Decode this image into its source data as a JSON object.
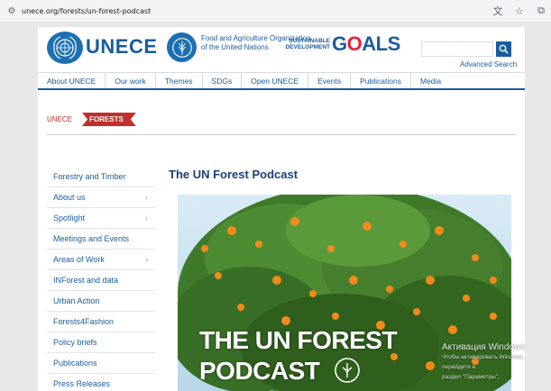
{
  "browser": {
    "url": "unece.org/forests/un-forest-podcast",
    "icons": [
      "tune-icon",
      "translate-icon",
      "star-icon",
      "extensions-icon"
    ]
  },
  "header": {
    "brand": "UNECE",
    "fao_line1": "Food and Agriculture Organization",
    "fao_line2": "of the United Nations",
    "sdg_line1": "SUSTAINABLE",
    "sdg_line2": "DEVELOPMENT",
    "sdg_goals_pre": "G",
    "sdg_goals_o": "O",
    "sdg_goals_post": "ALS",
    "search_placeholder": "",
    "advanced_search": "Advanced Search",
    "colors": {
      "brand_blue": "#1a5c9e",
      "accent_red": "#c12f2a"
    }
  },
  "topnav": {
    "items": [
      "About UNECE",
      "Our work",
      "Themes",
      "SDGs",
      "Open UNECE",
      "Events",
      "Publications",
      "Media"
    ]
  },
  "breadcrumb": {
    "root": "UNECE",
    "current": "FORESTS"
  },
  "sidebar": {
    "items": [
      {
        "label": "Forestry and Timber",
        "has_arrow": false
      },
      {
        "label": "About us",
        "has_arrow": true
      },
      {
        "label": "Spotlight",
        "has_arrow": true
      },
      {
        "label": "Meetings and Events",
        "has_arrow": false
      },
      {
        "label": "Areas of Work",
        "has_arrow": true
      },
      {
        "label": "INForest and data",
        "has_arrow": false
      },
      {
        "label": "Urban Action",
        "has_arrow": false
      },
      {
        "label": "Forests4Fashion",
        "has_arrow": false
      },
      {
        "label": "Policy briefs",
        "has_arrow": false
      },
      {
        "label": "Publications",
        "has_arrow": false
      },
      {
        "label": "Press Releases",
        "has_arrow": false
      }
    ]
  },
  "main": {
    "title": "The UN Forest Podcast",
    "image_line1": "THE UN FOREST",
    "image_line2": "PODCAST"
  },
  "watermark": {
    "line1": "Активация Windows",
    "line2": "Чтобы активировать Windows, перейдите в",
    "line3": "раздел \"Параметры\"."
  }
}
